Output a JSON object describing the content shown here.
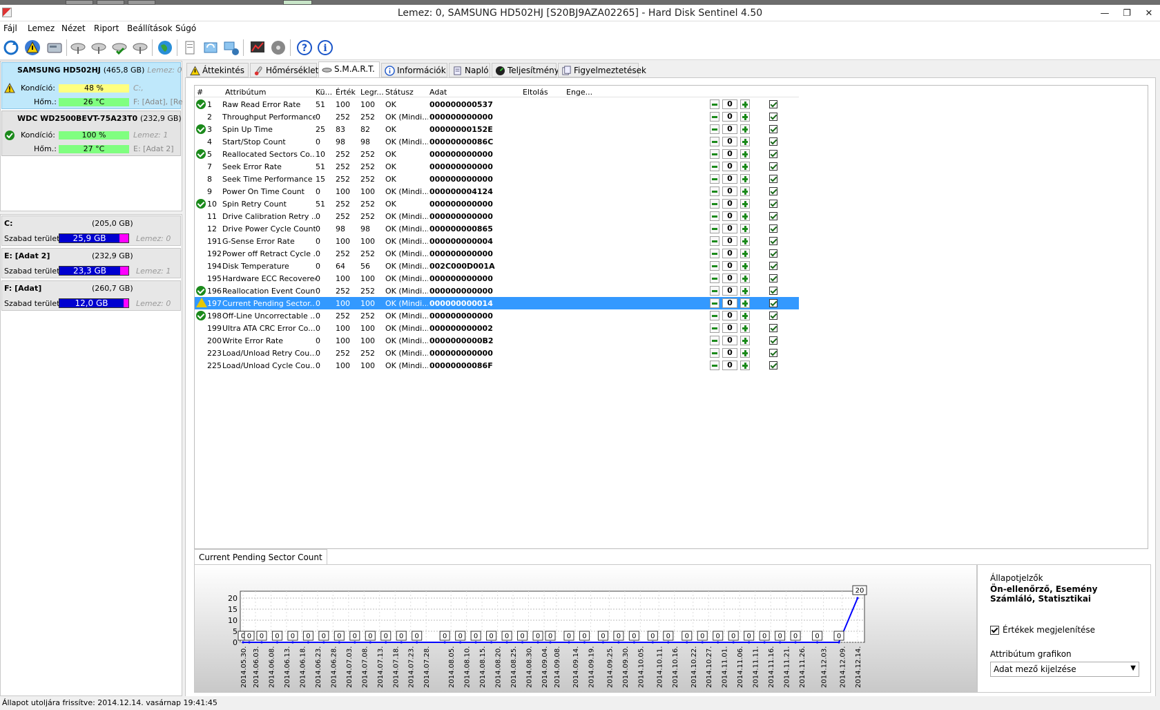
{
  "window": {
    "title": "Lemez: 0, SAMSUNG HD502HJ [S20BJ9AZA02265]  -  Hard Disk Sentinel 4.50"
  },
  "menu": [
    "Fájl",
    "Lemez",
    "Nézet",
    "Riport",
    "Beállítások",
    "Súgó"
  ],
  "drives": [
    {
      "name": "SAMSUNG HD502HJ",
      "size": "(465,8 GB)",
      "disk": "Lemez: 0",
      "condition_label": "Kondíció:",
      "condition": "48 %",
      "condition_pct": 48,
      "condition_color": "#ffff80",
      "vol1": "C:,",
      "temp_label": "Hőm.:",
      "temp": "26 °C",
      "vol2": "F: [Adat],  [Re"
    },
    {
      "name": "WDC WD2500BEVT-75A23T0",
      "size": "(232,9 GB)",
      "disk": "Lemez: 1",
      "condition_label": "Kondíció:",
      "condition": "100 %",
      "condition_pct": 100,
      "condition_color": "#80ff80",
      "vol1": "Lemez: 1",
      "temp_label": "Hőm.:",
      "temp": "27 °C",
      "vol2": "E: [Adat 2]"
    }
  ],
  "volumes": [
    {
      "name": "C:",
      "size": "(205,0 GB)",
      "free_label": "Szabad terület",
      "free": "25,9 GB",
      "free_pct": 87,
      "disk": "Lemez: 0"
    },
    {
      "name": "E: [Adat 2]",
      "size": "(232,9 GB)",
      "free_label": "Szabad terület",
      "free": "23,3 GB",
      "free_pct": 88,
      "disk": "Lemez: 1"
    },
    {
      "name": "F: [Adat]",
      "size": "(260,7 GB)",
      "free_label": "Szabad terület",
      "free": "12,0 GB",
      "free_pct": 93,
      "disk": "Lemez: 0"
    }
  ],
  "tabs": [
    "Áttekintés",
    "Hőmérséklet",
    "S.M.A.R.T.",
    "Információk",
    "Napló",
    "Teljesítmény",
    "Figyelmeztetések"
  ],
  "smart": {
    "headers": [
      "#",
      "Attribútum",
      "Kü...",
      "Érték",
      "Legr...",
      "Státusz",
      "Adat",
      "Eltolás",
      "Enge..."
    ],
    "rows": [
      {
        "icon": "ok",
        "id": "1",
        "name": "Raw Read Error Rate",
        "th": "51",
        "val": "100",
        "worst": "100",
        "status": "OK",
        "data": "000000000537",
        "offset": "0"
      },
      {
        "icon": "",
        "id": "2",
        "name": "Throughput Performance",
        "th": "0",
        "val": "252",
        "worst": "252",
        "status": "OK (Mindi...",
        "data": "000000000000",
        "offset": "0"
      },
      {
        "icon": "ok",
        "id": "3",
        "name": "Spin Up Time",
        "th": "25",
        "val": "83",
        "worst": "82",
        "status": "OK",
        "data": "00000000152E",
        "offset": "0"
      },
      {
        "icon": "",
        "id": "4",
        "name": "Start/Stop Count",
        "th": "0",
        "val": "98",
        "worst": "98",
        "status": "OK (Mindi...",
        "data": "00000000086C",
        "offset": "0"
      },
      {
        "icon": "ok",
        "id": "5",
        "name": "Reallocated Sectors Co...",
        "th": "10",
        "val": "252",
        "worst": "252",
        "status": "OK",
        "data": "000000000000",
        "offset": "0"
      },
      {
        "icon": "",
        "id": "7",
        "name": "Seek Error Rate",
        "th": "51",
        "val": "252",
        "worst": "252",
        "status": "OK",
        "data": "000000000000",
        "offset": "0"
      },
      {
        "icon": "",
        "id": "8",
        "name": "Seek Time Performance",
        "th": "15",
        "val": "252",
        "worst": "252",
        "status": "OK",
        "data": "000000000000",
        "offset": "0"
      },
      {
        "icon": "",
        "id": "9",
        "name": "Power On Time Count",
        "th": "0",
        "val": "100",
        "worst": "100",
        "status": "OK (Mindi...",
        "data": "000000004124",
        "offset": "0"
      },
      {
        "icon": "ok",
        "id": "10",
        "name": "Spin Retry Count",
        "th": "51",
        "val": "252",
        "worst": "252",
        "status": "OK",
        "data": "000000000000",
        "offset": "0"
      },
      {
        "icon": "",
        "id": "11",
        "name": "Drive Calibration Retry ...",
        "th": "0",
        "val": "252",
        "worst": "252",
        "status": "OK (Mindi...",
        "data": "000000000000",
        "offset": "0"
      },
      {
        "icon": "",
        "id": "12",
        "name": "Drive Power Cycle Count",
        "th": "0",
        "val": "98",
        "worst": "98",
        "status": "OK (Mindi...",
        "data": "000000000865",
        "offset": "0"
      },
      {
        "icon": "",
        "id": "191",
        "name": "G-Sense Error Rate",
        "th": "0",
        "val": "100",
        "worst": "100",
        "status": "OK (Mindi...",
        "data": "000000000004",
        "offset": "0"
      },
      {
        "icon": "",
        "id": "192",
        "name": "Power off Retract Cycle ...",
        "th": "0",
        "val": "252",
        "worst": "252",
        "status": "OK (Mindi...",
        "data": "000000000000",
        "offset": "0"
      },
      {
        "icon": "",
        "id": "194",
        "name": "Disk Temperature",
        "th": "0",
        "val": "64",
        "worst": "56",
        "status": "OK (Mindi...",
        "data": "002C000D001A",
        "offset": "0"
      },
      {
        "icon": "",
        "id": "195",
        "name": "Hardware ECC Recovered",
        "th": "0",
        "val": "100",
        "worst": "100",
        "status": "OK (Mindi...",
        "data": "000000000000",
        "offset": "0"
      },
      {
        "icon": "ok",
        "id": "196",
        "name": "Reallocation Event Count",
        "th": "0",
        "val": "252",
        "worst": "252",
        "status": "OK (Mindi...",
        "data": "000000000000",
        "offset": "0"
      },
      {
        "icon": "warn",
        "id": "197",
        "name": "Current Pending Sector...",
        "th": "0",
        "val": "100",
        "worst": "100",
        "status": "OK (Mindi...",
        "data": "000000000014",
        "offset": "0",
        "selected": true
      },
      {
        "icon": "ok",
        "id": "198",
        "name": "Off-Line Uncorrectable ...",
        "th": "0",
        "val": "252",
        "worst": "252",
        "status": "OK (Mindi...",
        "data": "000000000000",
        "offset": "0"
      },
      {
        "icon": "",
        "id": "199",
        "name": "Ultra ATA CRC Error Co...",
        "th": "0",
        "val": "100",
        "worst": "100",
        "status": "OK (Mindi...",
        "data": "000000000002",
        "offset": "0"
      },
      {
        "icon": "",
        "id": "200",
        "name": "Write Error Rate",
        "th": "0",
        "val": "100",
        "worst": "100",
        "status": "OK (Mindi...",
        "data": "0000000000B2",
        "offset": "0"
      },
      {
        "icon": "",
        "id": "223",
        "name": "Load/Unload Retry Cou...",
        "th": "0",
        "val": "252",
        "worst": "252",
        "status": "OK (Mindi...",
        "data": "000000000000",
        "offset": "0"
      },
      {
        "icon": "",
        "id": "225",
        "name": "Load/Unload Cycle Cou...",
        "th": "0",
        "val": "100",
        "worst": "100",
        "status": "OK (Mindi...",
        "data": "00000000086F",
        "offset": "0"
      }
    ]
  },
  "graph": {
    "tab_label": "Current Pending Sector Count",
    "side": {
      "indicators_label": "Állapotjelzők",
      "indicators_value": "Ön-ellenőrző, Esemény Számláló, Statisztikai",
      "show_values_label": "Értékek megjelenítése",
      "attr_graph_label": "Attribútum grafikon",
      "attr_graph_value": "Adat mező kijelzése"
    }
  },
  "chart_data": {
    "type": "line",
    "title": "",
    "yticks": [
      0,
      5,
      10,
      15,
      20
    ],
    "ylim": [
      0,
      20
    ],
    "x": [
      "2014.05.30.",
      "2014.06.03.",
      "2014.06.08.",
      "2014.06.13.",
      "2014.06.18.",
      "2014.06.23.",
      "2014.06.28.",
      "2014.07.03.",
      "2014.07.08.",
      "2014.07.13.",
      "2014.07.18.",
      "2014.07.23.",
      "2014.07.28.",
      "2014.08.05.",
      "2014.08.10.",
      "2014.08.15.",
      "2014.08.20.",
      "2014.08.25.",
      "2014.08.30.",
      "2014.09.04.",
      "2014.09.08.",
      "2014.09.14.",
      "2014.09.19.",
      "2014.09.25.",
      "2014.09.30.",
      "2014.10.05.",
      "2014.10.11.",
      "2014.10.16.",
      "2014.10.22.",
      "2014.10.27.",
      "2014.11.01.",
      "2014.11.06.",
      "2014.11.11.",
      "2014.11.16.",
      "2014.11.21.",
      "2014.11.26.",
      "2014.12.03.",
      "2014.12.09.",
      "2014.12.14."
    ],
    "points": [
      {
        "x": "2014.05.30.",
        "y": 0
      },
      {
        "x": "2014.06.01.",
        "y": 0
      },
      {
        "x": "2014.06.05.",
        "y": 0
      },
      {
        "x": "2014.06.10.",
        "y": 0
      },
      {
        "x": "2014.06.15.",
        "y": 0
      },
      {
        "x": "2014.06.20.",
        "y": 0
      },
      {
        "x": "2014.06.25.",
        "y": 0
      },
      {
        "x": "2014.06.30.",
        "y": 0
      },
      {
        "x": "2014.07.05.",
        "y": 0
      },
      {
        "x": "2014.07.10.",
        "y": 0
      },
      {
        "x": "2014.07.15.",
        "y": 0
      },
      {
        "x": "2014.07.20.",
        "y": 0
      },
      {
        "x": "2014.07.25.",
        "y": 0
      },
      {
        "x": "2014.08.03.",
        "y": 0
      },
      {
        "x": "2014.08.08.",
        "y": 0
      },
      {
        "x": "2014.08.13.",
        "y": 0
      },
      {
        "x": "2014.08.18.",
        "y": 0
      },
      {
        "x": "2014.08.23.",
        "y": 0
      },
      {
        "x": "2014.08.28.",
        "y": 0
      },
      {
        "x": "2014.09.02.",
        "y": 0
      },
      {
        "x": "2014.09.06.",
        "y": 0
      },
      {
        "x": "2014.09.12.",
        "y": 0
      },
      {
        "x": "2014.09.17.",
        "y": 0
      },
      {
        "x": "2014.09.23.",
        "y": 0
      },
      {
        "x": "2014.09.28.",
        "y": 0
      },
      {
        "x": "2014.10.03.",
        "y": 0
      },
      {
        "x": "2014.10.09.",
        "y": 0
      },
      {
        "x": "2014.10.14.",
        "y": 0
      },
      {
        "x": "2014.10.20.",
        "y": 0
      },
      {
        "x": "2014.10.25.",
        "y": 0
      },
      {
        "x": "2014.10.30.",
        "y": 0
      },
      {
        "x": "2014.11.04.",
        "y": 0
      },
      {
        "x": "2014.11.09.",
        "y": 0
      },
      {
        "x": "2014.11.14.",
        "y": 0
      },
      {
        "x": "2014.11.19.",
        "y": 0
      },
      {
        "x": "2014.11.24.",
        "y": 0
      },
      {
        "x": "2014.12.01.",
        "y": 0
      },
      {
        "x": "2014.12.08.",
        "y": 0
      },
      {
        "x": "2014.12.14.",
        "y": 20
      }
    ],
    "line_color": "#0000ff",
    "grid": true
  },
  "status": "Állapot utoljára frissítve: 2014.12.14. vasárnap 19:41:45",
  "colors": {
    "selected_row": "#3399ff",
    "free_fill": "#0000d0",
    "free_rest": "#ff00ff",
    "ok_green": "#1b8a1b",
    "warn_yellow": "#e8c800"
  }
}
